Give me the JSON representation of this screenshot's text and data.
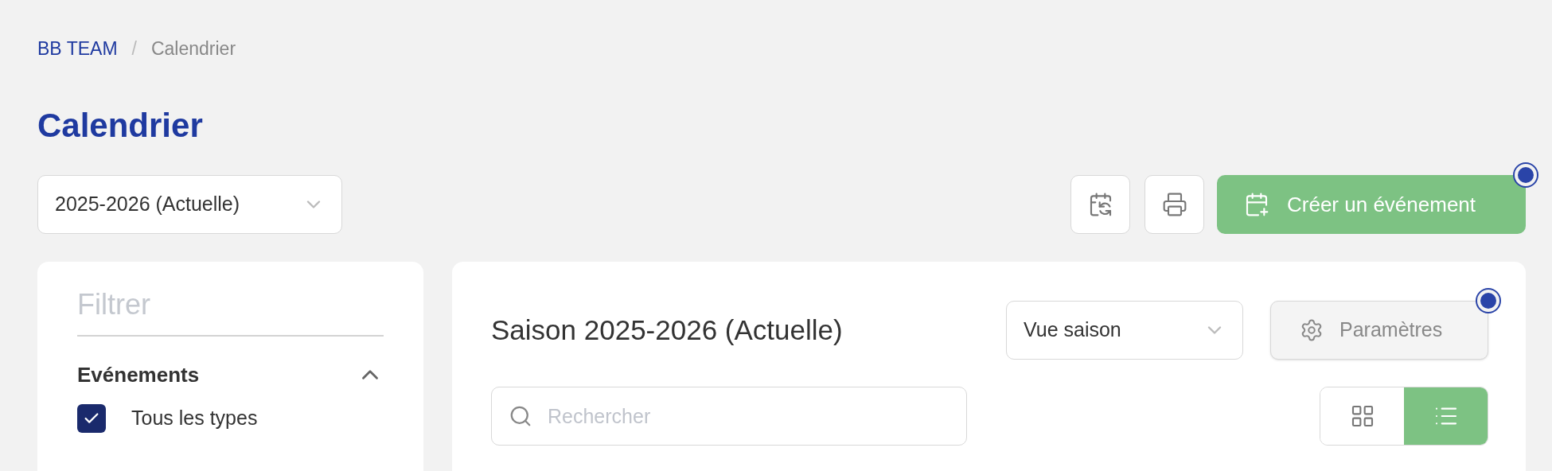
{
  "breadcrumb": [
    {
      "label": "BB TEAM",
      "kind": "link"
    },
    {
      "label": "Calendrier",
      "kind": "current"
    }
  ],
  "breadcrumb_separator": "/",
  "title": "Calendrier",
  "season_select": {
    "value": "2025-2026 (Actuelle)"
  },
  "toolbar": {
    "sync_button": {
      "kind": "icon"
    },
    "print_button": {
      "kind": "icon"
    },
    "create_button": {
      "label": "Créer un événement",
      "indicator": true
    }
  },
  "filter_panel": {
    "title": "Filtrer",
    "sections": [
      {
        "title": "Evénements",
        "expanded": true,
        "options": [
          {
            "label": "Tous les types",
            "checked": true
          }
        ]
      }
    ]
  },
  "main": {
    "title": "Saison 2025-2026 (Actuelle)",
    "view_select": {
      "value": "Vue saison"
    },
    "settings_button": {
      "label": "Paramètres",
      "indicator": true
    },
    "search": {
      "placeholder": "Rechercher"
    },
    "view_toggle": [
      {
        "kind": "grid",
        "selected": false
      },
      {
        "kind": "list",
        "selected": true
      }
    ]
  }
}
